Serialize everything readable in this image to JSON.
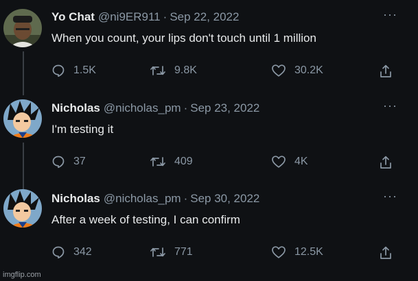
{
  "tweets": [
    {
      "name": "Yo Chat",
      "handle": "@ni9ER911",
      "separator": "·",
      "date": "Sep 22, 2022",
      "text": "When you count, your lips don't touch until 1 million",
      "replies": "1.5K",
      "retweets": "9.8K",
      "likes": "30.2K"
    },
    {
      "name": "Nicholas",
      "handle": "@nicholas_pm",
      "separator": "·",
      "date": "Sep 23, 2022",
      "text": "I'm testing it",
      "replies": "37",
      "retweets": "409",
      "likes": "4K"
    },
    {
      "name": "Nicholas",
      "handle": "@nicholas_pm",
      "separator": "·",
      "date": "Sep 30, 2022",
      "text": "After a week of testing, I can confirm",
      "replies": "342",
      "retweets": "771",
      "likes": "12.5K"
    }
  ],
  "more_label": "···",
  "watermark": "imgflip.com",
  "icons": {
    "reply": "reply-icon",
    "retweet": "retweet-icon",
    "like": "heart-icon",
    "share": "share-icon"
  },
  "colors": {
    "background": "#0f1114",
    "text": "#e7e9ea",
    "muted": "#8b98a5"
  }
}
